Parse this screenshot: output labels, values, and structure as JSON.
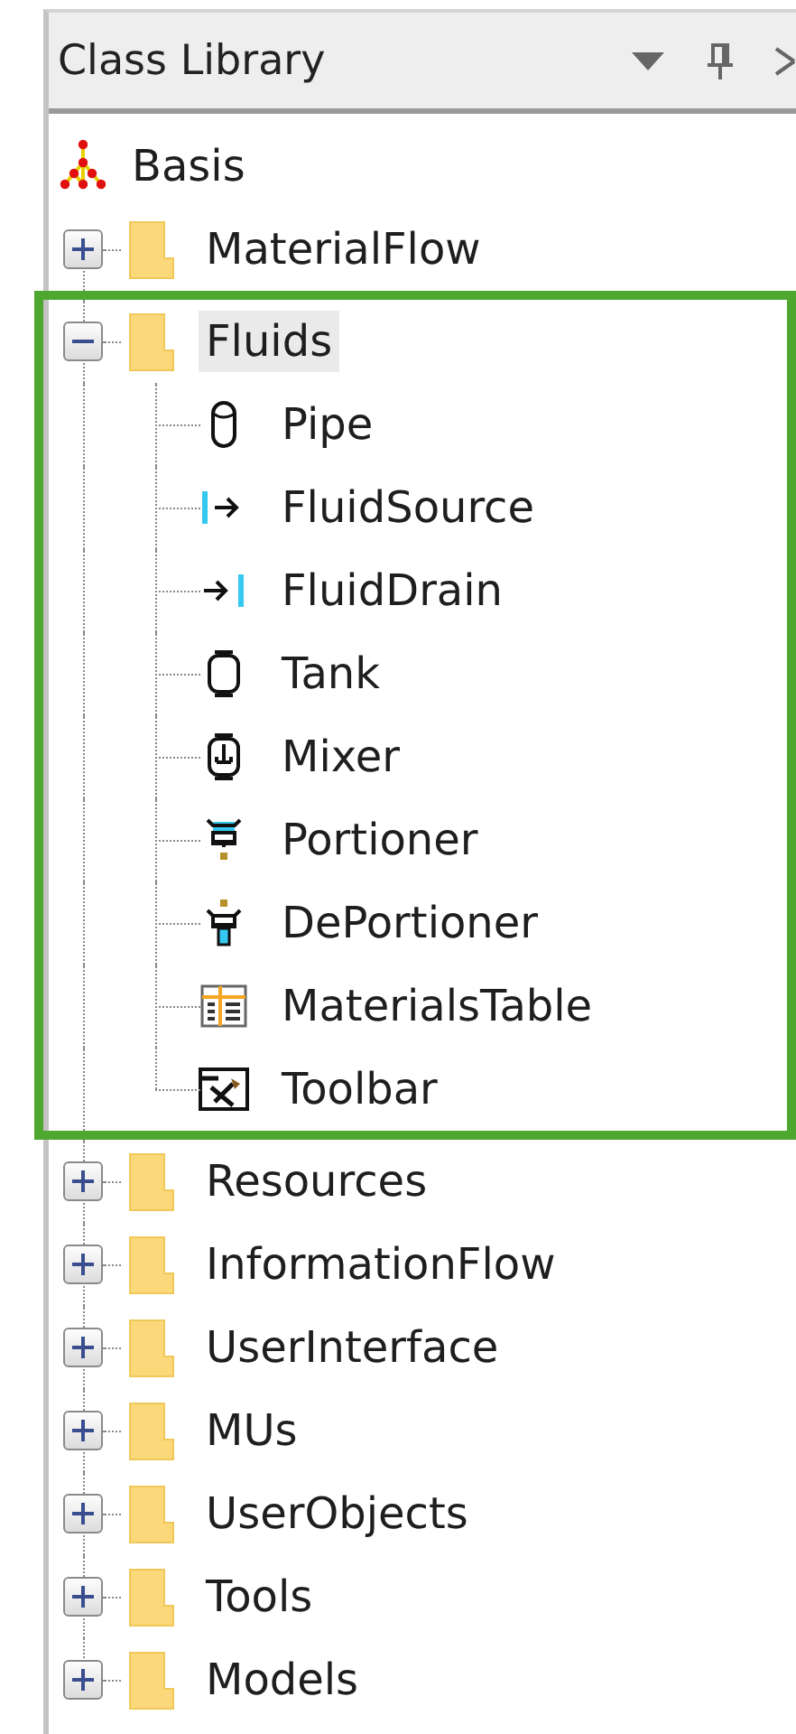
{
  "panel": {
    "title": "Class Library"
  },
  "tree": {
    "label": "Basis",
    "children": [
      {
        "label": "MaterialFlow",
        "expanded": false,
        "selected": false,
        "highlighted": false
      },
      {
        "label": "Fluids",
        "expanded": true,
        "selected": true,
        "highlighted": true,
        "children": [
          {
            "kind": "pipe",
            "label": "Pipe"
          },
          {
            "kind": "source",
            "label": "FluidSource"
          },
          {
            "kind": "drain",
            "label": "FluidDrain"
          },
          {
            "kind": "tank",
            "label": "Tank"
          },
          {
            "kind": "mixer",
            "label": "Mixer"
          },
          {
            "kind": "portioner",
            "label": "Portioner"
          },
          {
            "kind": "deportioner",
            "label": "DePortioner"
          },
          {
            "kind": "table",
            "label": "MaterialsTable"
          },
          {
            "kind": "toolbar",
            "label": "Toolbar"
          }
        ]
      },
      {
        "label": "Resources",
        "expanded": false,
        "selected": false,
        "highlighted": false
      },
      {
        "label": "InformationFlow",
        "expanded": false,
        "selected": false,
        "highlighted": false
      },
      {
        "label": "UserInterface",
        "expanded": false,
        "selected": false,
        "highlighted": false
      },
      {
        "label": "MUs",
        "expanded": false,
        "selected": false,
        "highlighted": false
      },
      {
        "label": "UserObjects",
        "expanded": false,
        "selected": false,
        "highlighted": false
      },
      {
        "label": "Tools",
        "expanded": false,
        "selected": false,
        "highlighted": false
      },
      {
        "label": "Models",
        "expanded": false,
        "selected": false,
        "highlighted": false
      }
    ]
  }
}
